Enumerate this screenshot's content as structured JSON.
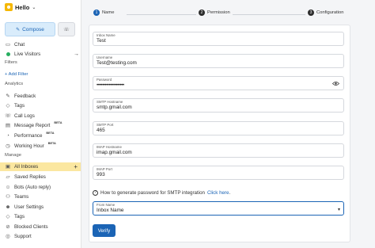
{
  "brand": {
    "logo": "☻",
    "name": "Hello"
  },
  "sidebar": {
    "compose_label": "Compose",
    "primary": [
      {
        "label": "Chat",
        "icon": "chat-icon"
      },
      {
        "label": "Live Visitors",
        "icon": "live-dot"
      }
    ],
    "filters_label": "Filters",
    "add_filter": "+ Add Filter",
    "analytics_label": "Analytics",
    "analytics": [
      {
        "label": "Feedback"
      },
      {
        "label": "Tags"
      },
      {
        "label": "Call Logs"
      },
      {
        "label": "Message Report",
        "badge": "BETA"
      },
      {
        "label": "Performance",
        "badge": "BETA"
      },
      {
        "label": "Working Hour",
        "badge": "BETA"
      }
    ],
    "manage_label": "Manage",
    "manage": [
      {
        "label": "All Inboxes",
        "active": true
      },
      {
        "label": "Saved Replies"
      },
      {
        "label": "Bots (Auto reply)"
      },
      {
        "label": "Teams"
      },
      {
        "label": "User Settings"
      },
      {
        "label": "Tags"
      },
      {
        "label": "Blocked Clients"
      },
      {
        "label": "Support"
      }
    ],
    "add_symbol": "+",
    "arrow_symbol": "→"
  },
  "steps": [
    {
      "num": "1",
      "label": "Name"
    },
    {
      "num": "2",
      "label": "Permission"
    },
    {
      "num": "3",
      "label": "Configuration"
    }
  ],
  "form": {
    "inbox_name": {
      "label": "Inbox Name",
      "value": "Test"
    },
    "username": {
      "label": "Username",
      "value": "Test@testing.com"
    },
    "password": {
      "label": "Password",
      "value": "••••••••••••••••••••"
    },
    "smtp_host": {
      "label": "SMTP Hostname",
      "value": "smtp.gmail.com"
    },
    "smtp_port": {
      "label": "SMTP Port",
      "value": "465"
    },
    "imap_host": {
      "label": "IMAP Hostname",
      "value": "imap.gmail.com"
    },
    "imap_port": {
      "label": "IMAP Port",
      "value": "993"
    },
    "help_text": "How to generate password for SMTP integration",
    "help_link": "Click here",
    "help_end": ".",
    "from_name": {
      "label": "From Name",
      "value": "Inbox Name"
    },
    "verify_label": "Verify"
  }
}
